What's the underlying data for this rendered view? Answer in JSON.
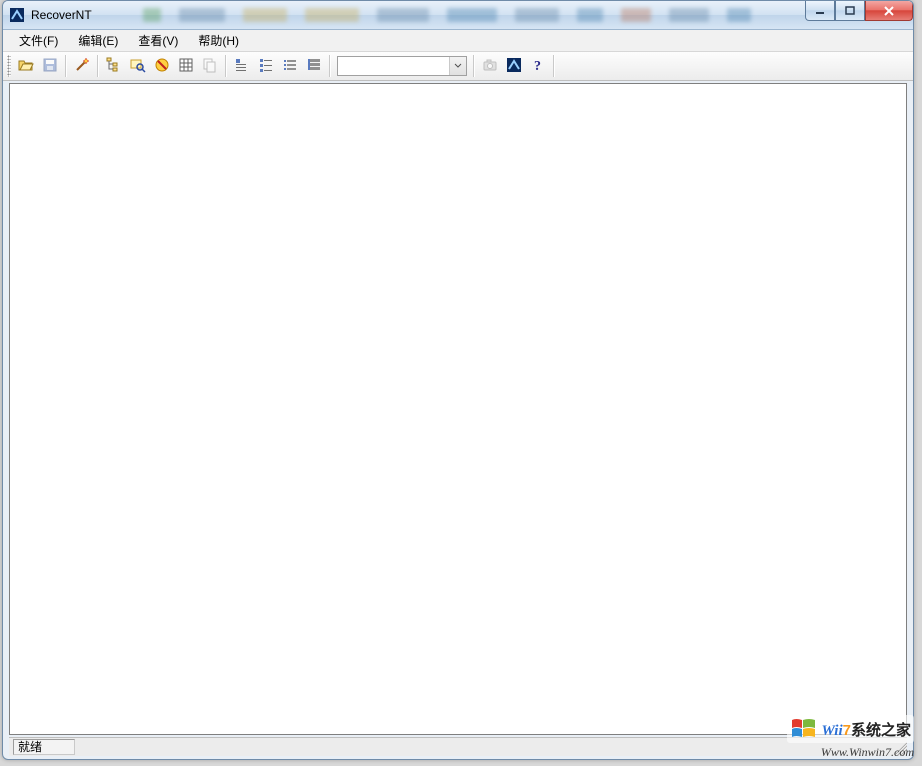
{
  "window": {
    "title": "RecoverNT",
    "controls": {
      "minimize": "minimize",
      "maximize": "maximize",
      "close": "close"
    }
  },
  "menubar": {
    "items": [
      {
        "label": "文件(F)"
      },
      {
        "label": "编辑(E)"
      },
      {
        "label": "查看(V)"
      },
      {
        "label": "帮助(H)"
      }
    ]
  },
  "toolbar": {
    "buttons": [
      {
        "name": "open-icon"
      },
      {
        "name": "save-icon"
      },
      {
        "name": "wand-icon"
      },
      {
        "name": "tree-icon"
      },
      {
        "name": "search-icon"
      },
      {
        "name": "refresh-icon"
      },
      {
        "name": "grid-icon"
      },
      {
        "name": "copy-icon"
      },
      {
        "name": "detail-small-icon"
      },
      {
        "name": "detail-medium-icon"
      },
      {
        "name": "detail-list-icon"
      },
      {
        "name": "detail-large-icon"
      }
    ],
    "combo": {
      "value": ""
    },
    "buttons_after": [
      {
        "name": "camera-icon"
      },
      {
        "name": "app-icon"
      },
      {
        "name": "help-icon"
      }
    ]
  },
  "statusbar": {
    "ready": "就绪"
  },
  "watermark": {
    "brand_prefix": "Wii",
    "brand_seven": "7",
    "brand_suffix": "系统之家",
    "url": "Www.Winwin7.com"
  }
}
